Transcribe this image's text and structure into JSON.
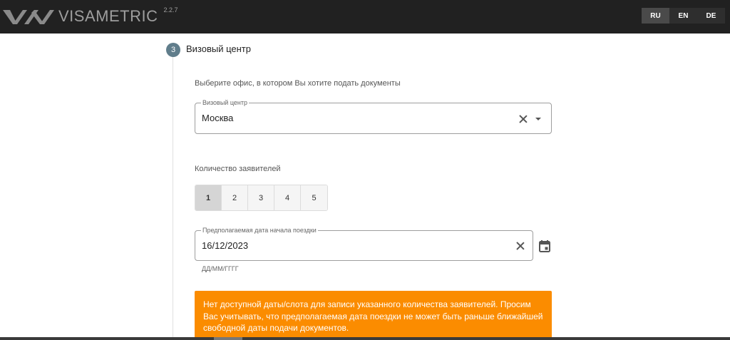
{
  "header": {
    "brand": "VISAMETRIC",
    "version": "2.2.7",
    "languages": [
      {
        "label": "RU",
        "active": true
      },
      {
        "label": "EN",
        "active": false
      },
      {
        "label": "DE",
        "active": false
      }
    ],
    "background_color": "#212121"
  },
  "step": {
    "number": "3",
    "title": "Визовый центр",
    "circle_color": "#607d8b"
  },
  "office": {
    "helper_text": "Выберите офис, в котором Вы хотите подать документы",
    "field_label": "Визовый центр",
    "value": "Москва",
    "clear_icon": "close-icon",
    "dropdown_icon": "chevron-down-icon"
  },
  "applicants": {
    "label": "Количество заявителей",
    "options": [
      "1",
      "2",
      "3",
      "4",
      "5"
    ],
    "selected": "1"
  },
  "trip_date": {
    "field_label": "Предполагаемая дата начала поездки",
    "value": "16/12/2023",
    "hint": "ДД/ММ/ГГГГ",
    "clear_icon": "close-icon",
    "calendar_icon": "calendar-icon"
  },
  "alert": {
    "text": "Нет доступной даты/слота для записи указанного количества заявителей. Просим Вас учитывать, что предполагаемая дата поездки не может быть раньше ближайшей свободной даты подачи документов.",
    "color": "#fb8c00"
  }
}
